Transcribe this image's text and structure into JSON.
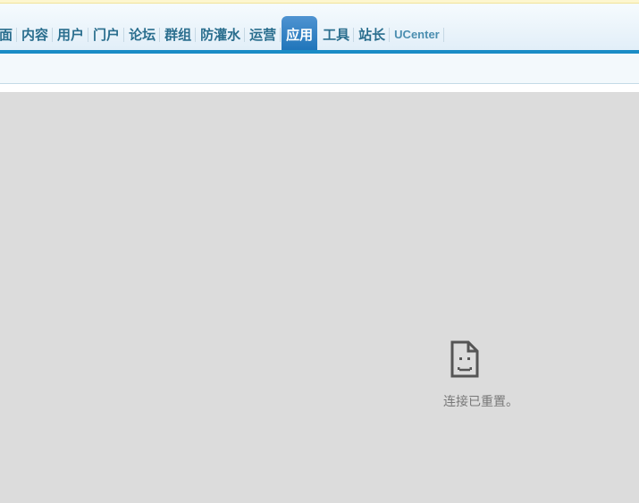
{
  "nav": {
    "items": [
      {
        "label": "面",
        "active": false
      },
      {
        "label": "内容",
        "active": false
      },
      {
        "label": "用户",
        "active": false
      },
      {
        "label": "门户",
        "active": false
      },
      {
        "label": "论坛",
        "active": false
      },
      {
        "label": "群组",
        "active": false
      },
      {
        "label": "防灌水",
        "active": false
      },
      {
        "label": "运营",
        "active": false
      },
      {
        "label": "应用",
        "active": true
      },
      {
        "label": "工具",
        "active": false
      },
      {
        "label": "站长",
        "active": false
      },
      {
        "label": "UCenter",
        "active": false
      }
    ]
  },
  "error": {
    "icon": "sad-document-icon",
    "message": "连接已重置。"
  },
  "colors": {
    "nav_text": "#2a6e8e",
    "active_tab": "#1e74b9",
    "nav_bar": "#1a8cc6",
    "content_bg": "#dcdcdc",
    "error_text": "#787878"
  }
}
